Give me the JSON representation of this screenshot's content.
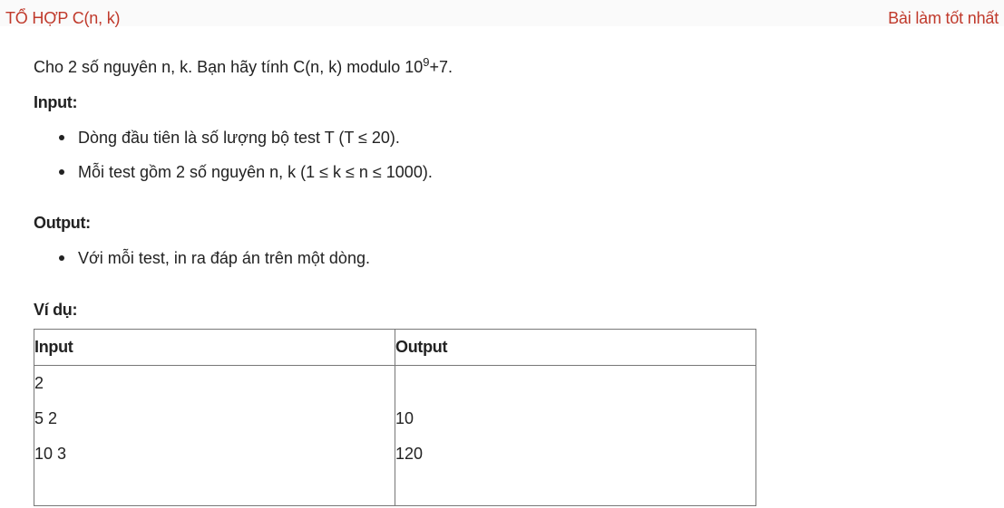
{
  "header": {
    "title": "TỔ HỢP C(n, k)",
    "best_solution_link": "Bài làm tốt nhất"
  },
  "problem": {
    "intro_before": "Cho 2 số nguyên n, k. Bạn hãy tính C(n, k) modulo 10",
    "intro_sup": "9",
    "intro_after": "+7.",
    "input_heading": "Input:",
    "input_bullets": [
      "Dòng đầu tiên là số lượng bộ test T (T ≤ 20).",
      "Mỗi test gồm 2 số nguyên n, k (1 ≤ k ≤ n ≤ 1000)."
    ],
    "output_heading": "Output:",
    "output_bullets": [
      "Với mỗi test, in ra đáp án trên một dòng."
    ],
    "example_heading": "Ví dụ:"
  },
  "example_table": {
    "headers": [
      "Input",
      "Output"
    ],
    "input_lines": [
      "2",
      "5 2",
      "10 3"
    ],
    "output_lines": [
      "",
      "10",
      "120"
    ]
  },
  "colors": {
    "accent": "#c0392b",
    "text": "#222222",
    "border": "#777777"
  }
}
